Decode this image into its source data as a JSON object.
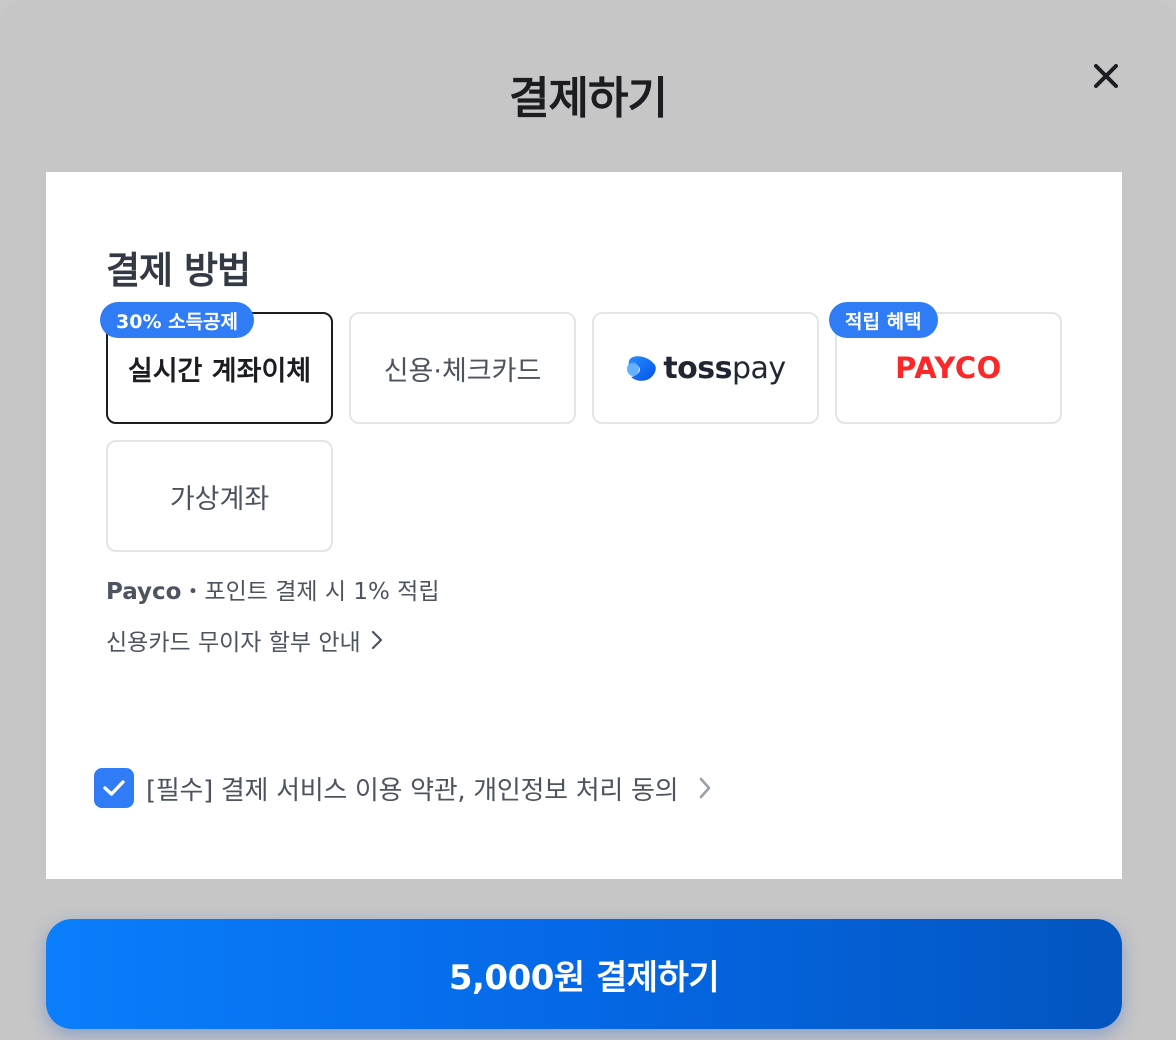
{
  "header": {
    "title": "결제하기"
  },
  "section": {
    "title": "결제 방법"
  },
  "methods": [
    {
      "label": "실시간 계좌이체",
      "badge": "30% 소득공제",
      "selected": true
    },
    {
      "label": "신용·체크카드"
    },
    {
      "label_bold": "toss",
      "label_rest": "pay",
      "icon": "toss-logo-icon"
    },
    {
      "label": "PAYCO",
      "badge": "적립 혜택",
      "brand_color": "#fa2828"
    },
    {
      "label": "가상계좌"
    }
  ],
  "info": {
    "payco_brand": "Payco",
    "payco_text": "・포인트 결제 시 1% 적립",
    "installment": "신용카드 무이자 할부 안내"
  },
  "agreement": {
    "checked": true,
    "text": "[필수] 결제 서비스 이용 약관, 개인정보 처리 동의"
  },
  "pay_button": {
    "label": "5,000원 결제하기"
  },
  "colors": {
    "accent": "#2f7cf6",
    "button": "#0568e6",
    "payco": "#fa2828"
  }
}
